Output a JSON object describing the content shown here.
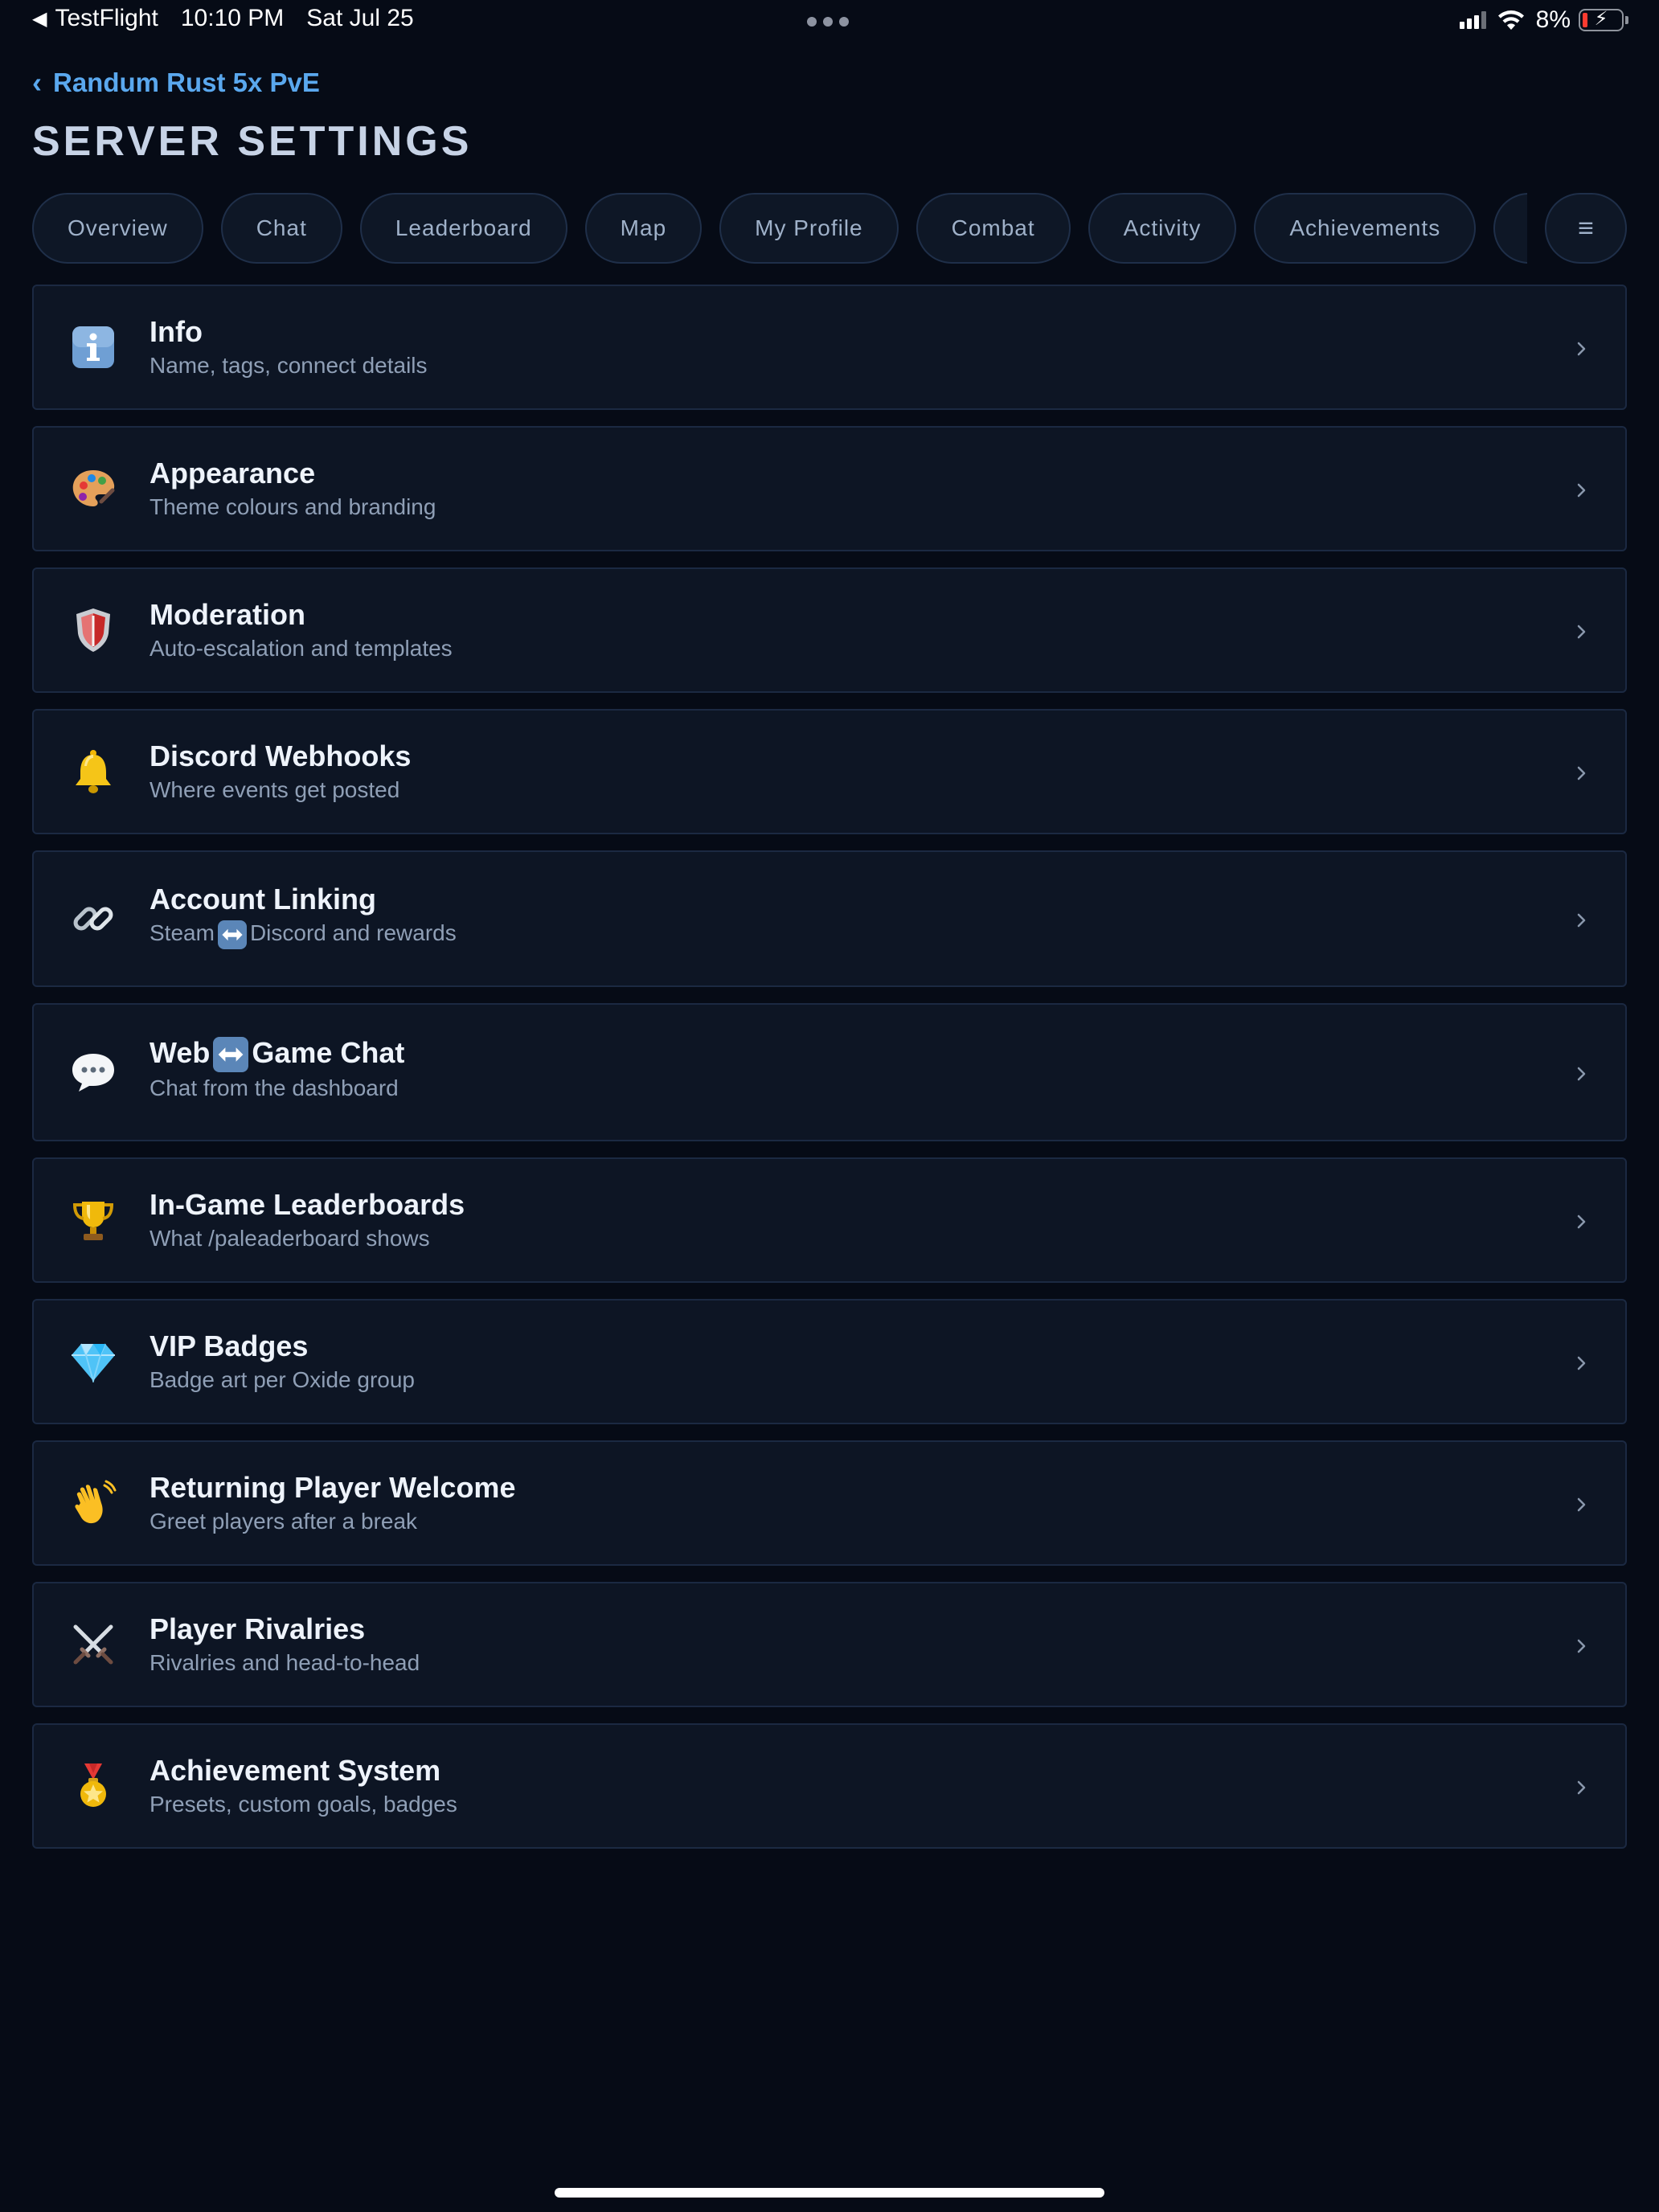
{
  "status_bar": {
    "back_app": "TestFlight",
    "time": "10:10 PM",
    "date": "Sat Jul 25",
    "battery_percent": "8%",
    "battery_level": 0.08,
    "battery_color": "#ff3b30"
  },
  "header": {
    "back_label": "Randum Rust 5x PvE",
    "title": "SERVER SETTINGS"
  },
  "tabs": [
    {
      "label": "Overview"
    },
    {
      "label": "Chat"
    },
    {
      "label": "Leaderboard"
    },
    {
      "label": "Map"
    },
    {
      "label": "My Profile"
    },
    {
      "label": "Combat"
    },
    {
      "label": "Activity"
    },
    {
      "label": "Achievements"
    },
    {
      "label": ""
    }
  ],
  "tab_more_label": "≡",
  "settings": [
    {
      "icon": "info-icon",
      "title": "Info",
      "subtitle": "Name, tags, connect details"
    },
    {
      "icon": "palette-icon",
      "title": "Appearance",
      "subtitle": "Theme colours and branding"
    },
    {
      "icon": "shield-icon",
      "title": "Moderation",
      "subtitle": "Auto-escalation and templates"
    },
    {
      "icon": "bell-icon",
      "title": "Discord Webhooks",
      "subtitle": "Where events get posted"
    },
    {
      "icon": "link-icon",
      "title": "Account Linking",
      "subtitle_before": "Steam",
      "subtitle_after": "Discord and rewards"
    },
    {
      "icon": "speech-bubble-icon",
      "title_before": "Web",
      "title_after": "Game Chat",
      "subtitle": "Chat from the dashboard"
    },
    {
      "icon": "trophy-icon",
      "title": "In-Game Leaderboards",
      "subtitle": "What /paleaderboard shows"
    },
    {
      "icon": "gem-icon",
      "title": "VIP Badges",
      "subtitle": "Badge art per Oxide group"
    },
    {
      "icon": "waving-hand-icon",
      "title": "Returning Player Welcome",
      "subtitle": "Greet players after a break"
    },
    {
      "icon": "crossed-swords-icon",
      "title": "Player Rivalries",
      "subtitle": "Rivalries and head-to-head"
    },
    {
      "icon": "medal-icon",
      "title": "Achievement System",
      "subtitle": "Presets, custom goals, badges"
    }
  ],
  "colors": {
    "background": "#060b16",
    "card": "#0d1524",
    "card_border": "#1b2942",
    "accent_link": "#5aa8ee",
    "title_text": "#c7d3e6",
    "subtitle_text": "#8f9fb6"
  }
}
